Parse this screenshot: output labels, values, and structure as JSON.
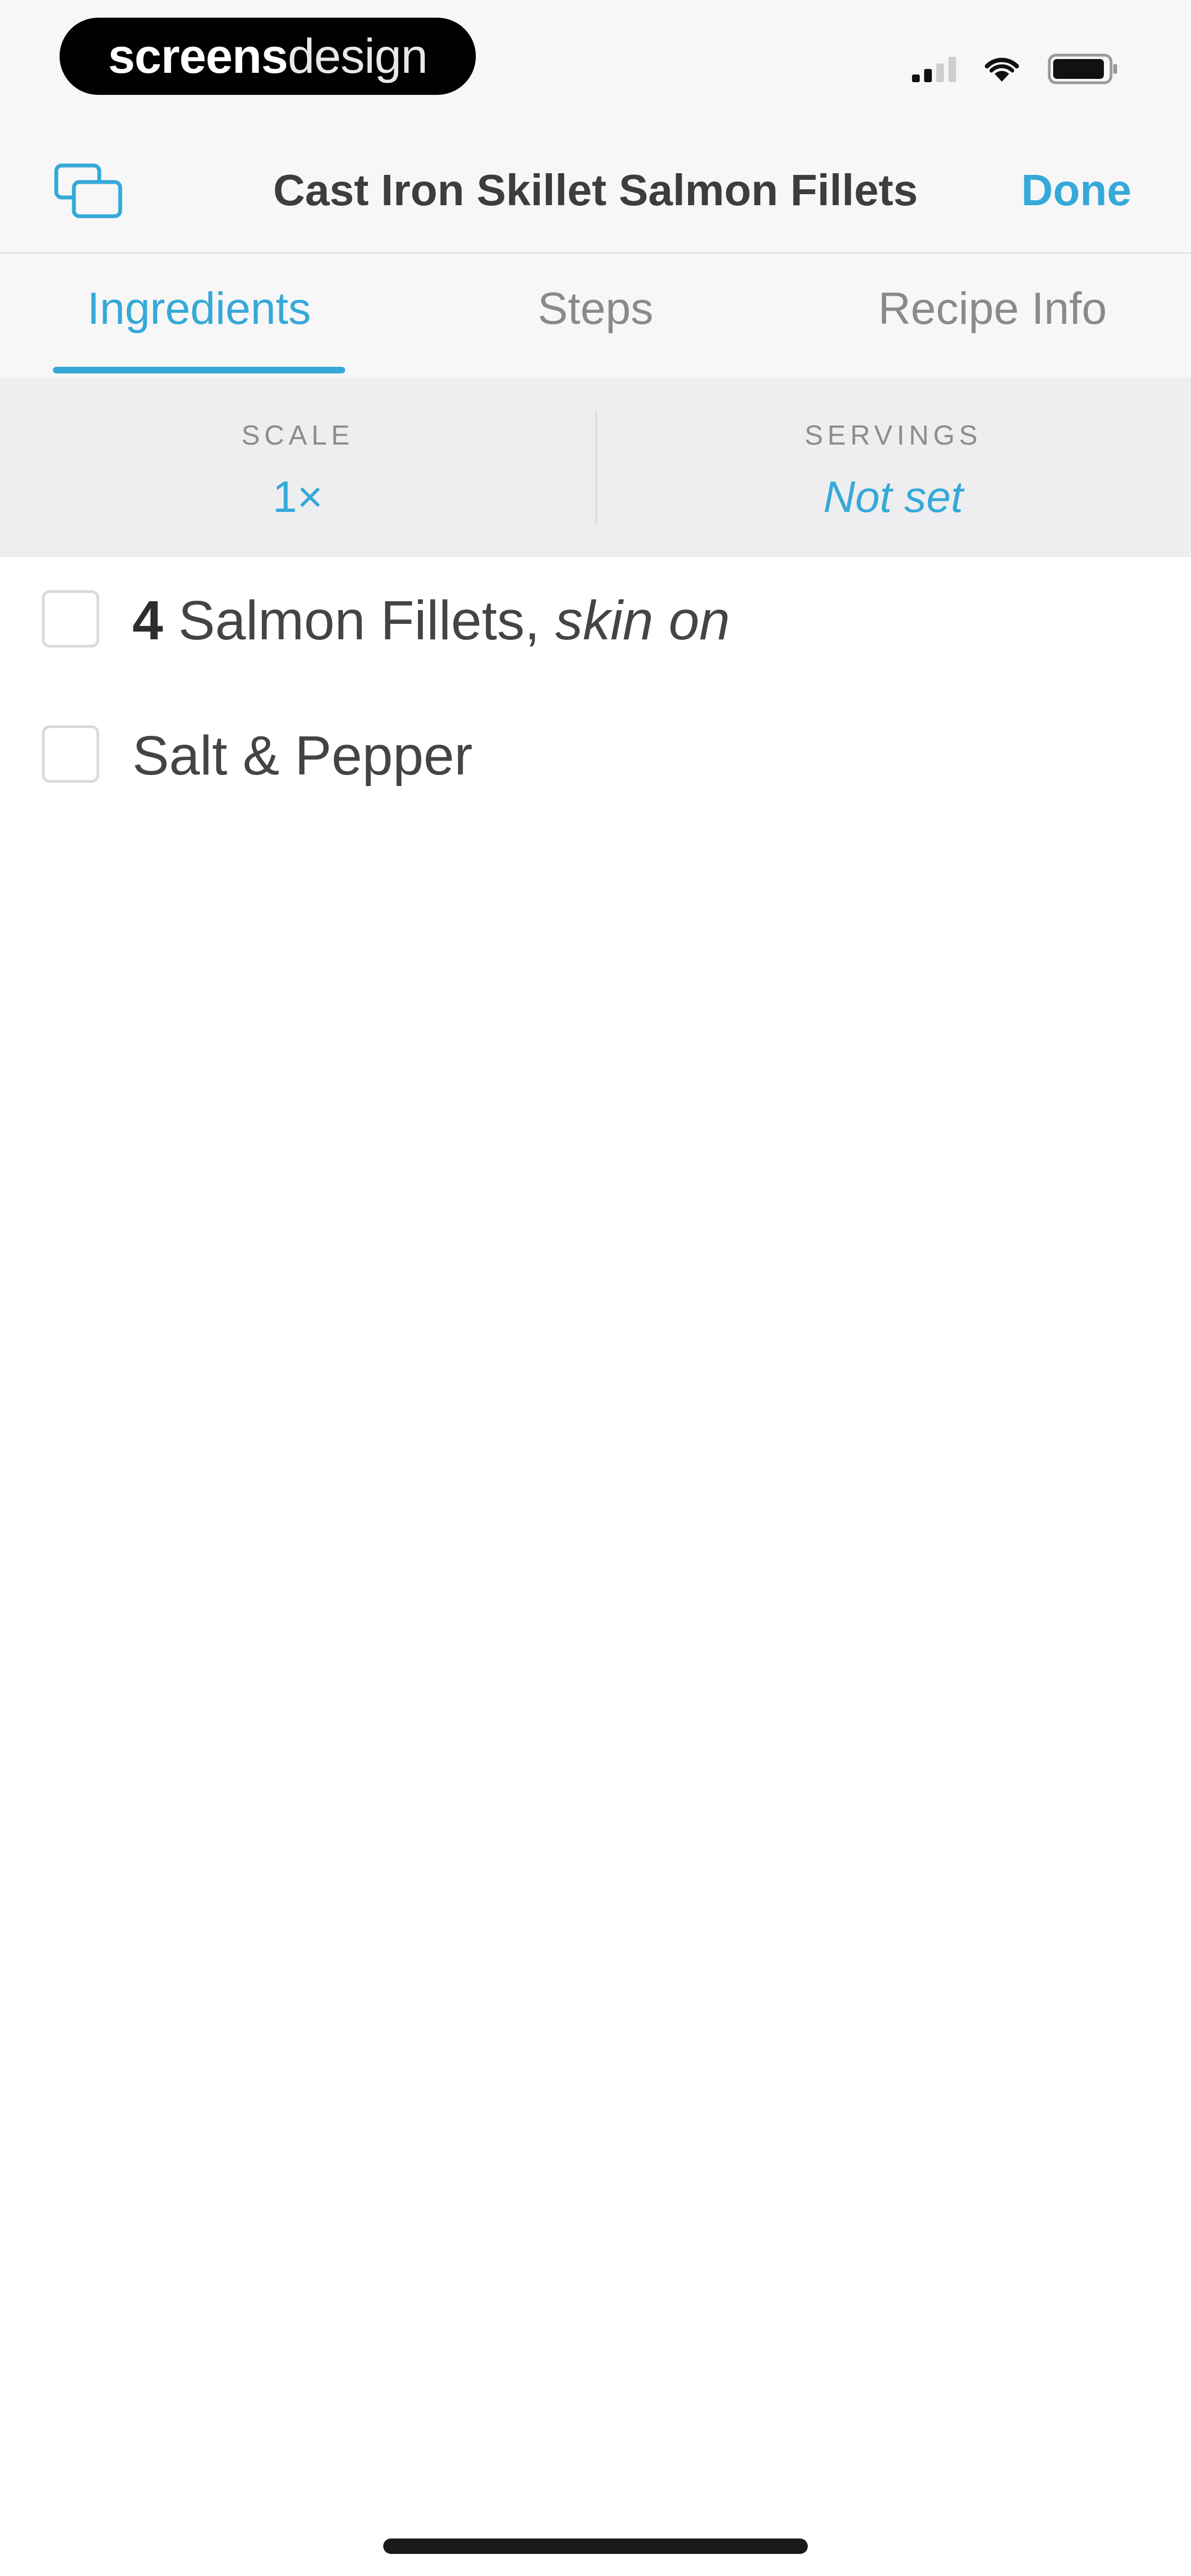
{
  "status_bar": {
    "brand_part1": "screens",
    "brand_part2": "design"
  },
  "nav": {
    "title": "Cast Iron Skillet Salmon Fillets",
    "done_label": "Done",
    "left_icon": "overlapping-cards-icon"
  },
  "tabs": [
    {
      "label": "Ingredients",
      "active": true
    },
    {
      "label": "Steps",
      "active": false
    },
    {
      "label": "Recipe Info",
      "active": false
    }
  ],
  "scale": {
    "scale_label": "SCALE",
    "scale_value": "1×",
    "servings_label": "SERVINGS",
    "servings_value": "Not set"
  },
  "ingredients": [
    {
      "quantity": "4",
      "name": "Salmon Fillets,",
      "note": "skin on",
      "checked": false
    },
    {
      "quantity": "",
      "name": "Salt & Pepper",
      "note": "",
      "checked": false
    }
  ],
  "colors": {
    "accent": "#35a9d8",
    "bar_background": "#f7f7f8",
    "scale_background": "#eeeef0"
  }
}
